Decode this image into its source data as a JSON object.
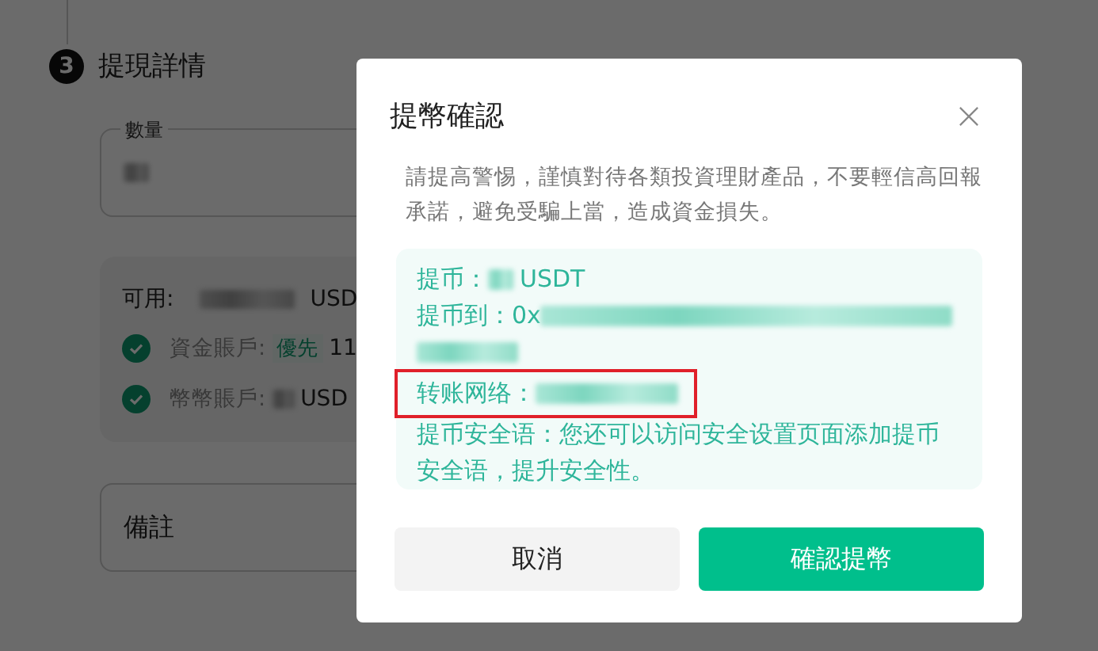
{
  "background": {
    "step": "3",
    "title": "提現詳情",
    "amount_field": {
      "label": "數量"
    },
    "balance_panel": {
      "available_label": "可用:",
      "available_unit": "USD",
      "accounts": [
        {
          "label": "資金賬戶:",
          "tag": "優先",
          "value": "11",
          "checked": true
        },
        {
          "label": "幣幣賬戶:",
          "value": "USD",
          "checked": true
        }
      ]
    },
    "note_field": {
      "placeholder": "備註"
    }
  },
  "dialog": {
    "title": "提幣確認",
    "warning": "請提高警惕，謹慎對待各類投資理財產品，不要輕信高回報承諾，避免受騙上當，造成資金損失。",
    "details": [
      {
        "kind": "currency",
        "label": "提币：",
        "value": "USDT",
        "highlighted": false
      },
      {
        "kind": "address",
        "label": "提币到：",
        "value": "0x",
        "highlighted": false
      },
      {
        "kind": "network",
        "label": "转账网络：",
        "highlighted": true
      },
      {
        "kind": "note",
        "text": "提币安全语：您还可以访问安全设置页面添加提币安全语，提升安全性。"
      }
    ],
    "buttons": [
      {
        "label": "取消",
        "kind": "secondary"
      },
      {
        "label": "確認提幣",
        "kind": "primary"
      }
    ]
  }
}
